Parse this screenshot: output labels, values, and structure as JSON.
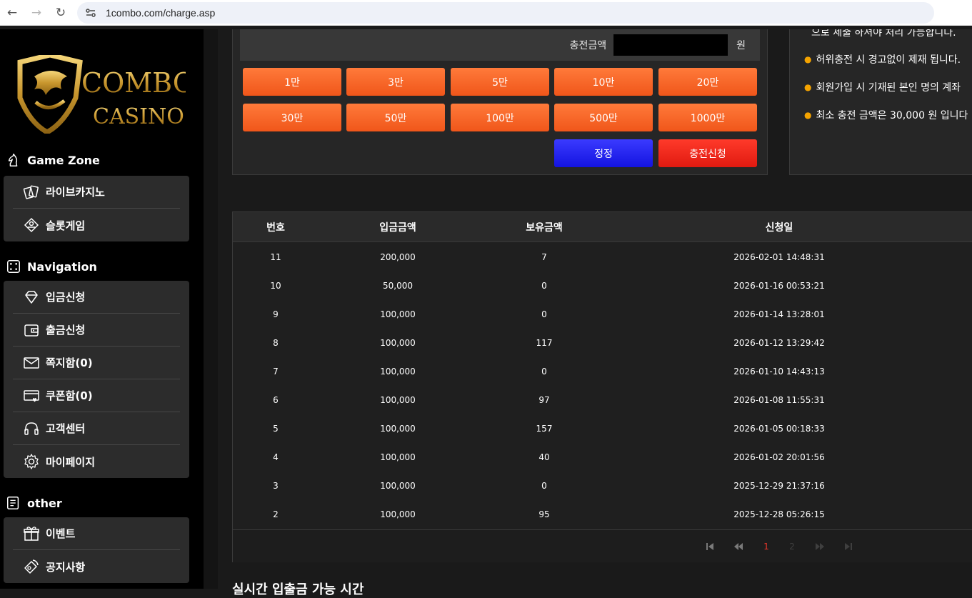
{
  "browser": {
    "url": "1combo.com/charge.asp",
    "back_icon": "back-arrow-icon",
    "forward_icon": "forward-arrow-icon",
    "reload_icon": "reload-icon",
    "site_info_icon": "site-settings-icon"
  },
  "logo": {
    "line1": "COMBO",
    "line2": "CASINO"
  },
  "sidebar": {
    "game_zone": {
      "title": "Game Zone",
      "items": [
        {
          "label": "라이브카지노",
          "icon": "cards-icon"
        },
        {
          "label": "슬롯게임",
          "icon": "slot-icon"
        }
      ]
    },
    "navigation": {
      "title": "Navigation",
      "items": [
        {
          "label": "입금신청",
          "icon": "diamond-icon"
        },
        {
          "label": "출금신청",
          "icon": "wallet-icon"
        },
        {
          "label": "쪽지함(0)",
          "icon": "mail-icon"
        },
        {
          "label": "쿠폰함(0)",
          "icon": "coupon-icon"
        },
        {
          "label": "고객센터",
          "icon": "headset-icon"
        },
        {
          "label": "마이페이지",
          "icon": "gear-icon"
        }
      ]
    },
    "other": {
      "title": "other",
      "items": [
        {
          "label": "이벤트",
          "icon": "gift-icon"
        },
        {
          "label": "공지사항",
          "icon": "megaphone-icon"
        }
      ]
    }
  },
  "charge": {
    "amount_label": "충전금액",
    "amount_value": "",
    "unit": "원",
    "amount_buttons": [
      "1만",
      "3만",
      "5만",
      "10만",
      "20만",
      "30만",
      "50만",
      "100만",
      "500만",
      "1000만"
    ],
    "reset_label": "정정",
    "apply_label": "충전신청"
  },
  "notices": {
    "partial_top": "으로 제출 하셔야 처리 가능합니다.",
    "items": [
      "허위충전 시 경고없이 제재 됩니다.",
      "회원가입 시 기재된 본인 명의 계좌",
      "최소 충전 금액은 30,000 원 입니다"
    ]
  },
  "history": {
    "headers": [
      "번호",
      "입금금액",
      "보유금액",
      "신청일"
    ],
    "rows": [
      [
        "11",
        "200,000",
        "7",
        "2026-02-01 14:48:31"
      ],
      [
        "10",
        "50,000",
        "0",
        "2026-01-16 00:53:21"
      ],
      [
        "9",
        "100,000",
        "0",
        "2026-01-14 13:28:01"
      ],
      [
        "8",
        "100,000",
        "117",
        "2026-01-12 13:29:42"
      ],
      [
        "7",
        "100,000",
        "0",
        "2026-01-10 14:43:13"
      ],
      [
        "6",
        "100,000",
        "97",
        "2026-01-08 11:55:31"
      ],
      [
        "5",
        "100,000",
        "157",
        "2026-01-05 00:18:33"
      ],
      [
        "4",
        "100,000",
        "40",
        "2026-01-02 20:01:56"
      ],
      [
        "3",
        "100,000",
        "0",
        "2025-12-29 21:37:16"
      ],
      [
        "2",
        "100,000",
        "95",
        "2025-12-28 05:26:15"
      ]
    ],
    "pagination": {
      "first_icon": "first-page-icon",
      "prev_icon": "prev-page-icon",
      "pages": [
        "1",
        "2"
      ],
      "current": "1",
      "next_icon": "next-page-icon",
      "last_icon": "last-page-icon"
    }
  },
  "footer_partial_title": "실시간 입출금 가능 시간",
  "colors": {
    "accent_orange": "#f0561a",
    "reset_blue": "#1414e0",
    "apply_red": "#e01a10",
    "gold": "#d4a640",
    "bullet": "#f4a300",
    "active_page": "#e8362b"
  }
}
